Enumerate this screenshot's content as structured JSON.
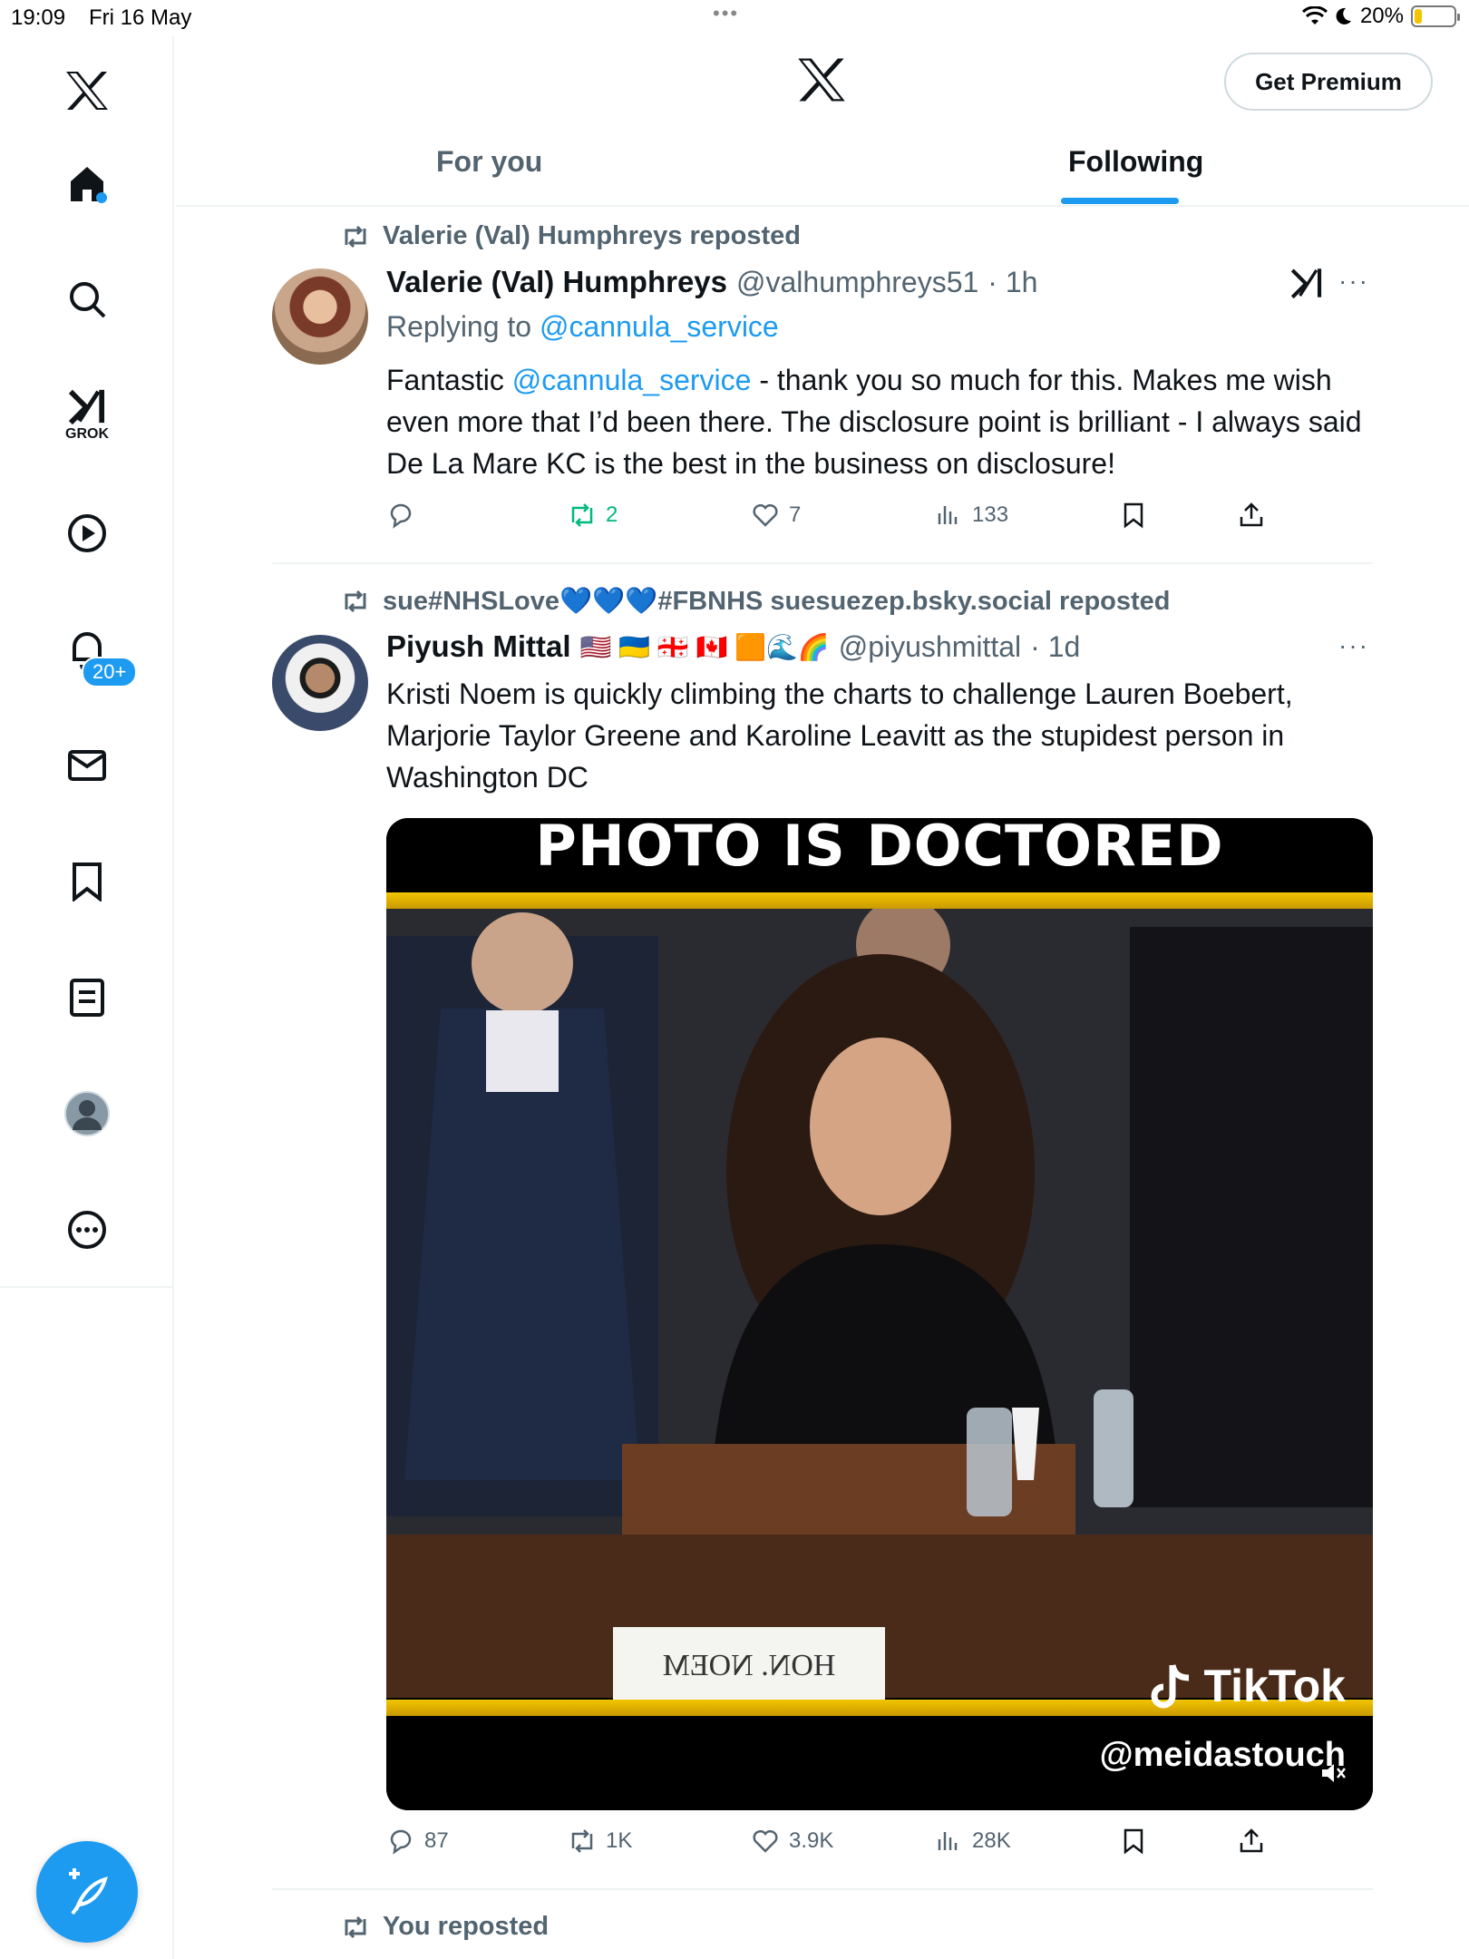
{
  "status_bar": {
    "time": "19:09",
    "date": "Fri 16 May",
    "battery": "20%",
    "battery_level": 0.2
  },
  "sidebar": {
    "items": [
      {
        "name": "home",
        "icon": "home-icon"
      },
      {
        "name": "explore",
        "icon": "search-icon"
      },
      {
        "name": "grok",
        "icon": "grok-icon",
        "label": "GROK"
      },
      {
        "name": "video",
        "icon": "play-icon"
      },
      {
        "name": "notifications",
        "icon": "bell-icon",
        "badge": "20+"
      },
      {
        "name": "messages",
        "icon": "mail-icon"
      },
      {
        "name": "bookmarks",
        "icon": "bookmark-icon"
      },
      {
        "name": "lists",
        "icon": "list-icon"
      },
      {
        "name": "profile",
        "icon": "profile-icon"
      },
      {
        "name": "more",
        "icon": "more-icon"
      }
    ]
  },
  "header": {
    "premium_label": "Get Premium",
    "tabs": [
      {
        "label": "For you",
        "active": false
      },
      {
        "label": "Following",
        "active": true
      }
    ]
  },
  "posts": [
    {
      "repost_label": "Valerie (Val) Humphreys reposted",
      "name": "Valerie (Val) Humphreys",
      "handle": "@valhumphreys51",
      "time": "· 1h",
      "reply_prefix": "Replying to",
      "reply_handle": "@cannula_service",
      "text_prefix": "Fantastic",
      "text_mention": "@cannula_service",
      "text_rest": " - thank you so much for this. Makes me wish even more that I’d been there. The disclosure point is brilliant - I always said De La Mare KC is the best in the business on disclosure!",
      "stats": {
        "replies": "",
        "reposts": "2",
        "likes": "7",
        "views": "133"
      }
    },
    {
      "repost_label": "sue#NHSLove💙💙💙#FBNHS suesuezep.bsky.social reposted",
      "name": "Piyush Mittal",
      "flags": "🇺🇸 🇺🇦 🇬🇪 🇨🇦 🟧🌊🌈",
      "handle": "@piyushmittal",
      "time": "· 1d",
      "text": "Kristi Noem is quickly climbing the charts to challenge Lauren Boebert, Marjorie Taylor Greene and Karoline Leavitt as the stupidest person in Washington DC",
      "media": {
        "headline": "PHOTO IS DOCTORED",
        "nameplate": "HON. NOEM",
        "watermark": "TikTok",
        "watermark_handle": "@meidastouch"
      },
      "stats": {
        "replies": "87",
        "reposts": "1K",
        "likes": "3.9K",
        "views": "28K"
      }
    },
    {
      "repost_label": "You reposted"
    }
  ],
  "colors": {
    "accent": "#1d9bf0",
    "repost_green": "#00ba7c",
    "secondary_text": "#536471"
  }
}
